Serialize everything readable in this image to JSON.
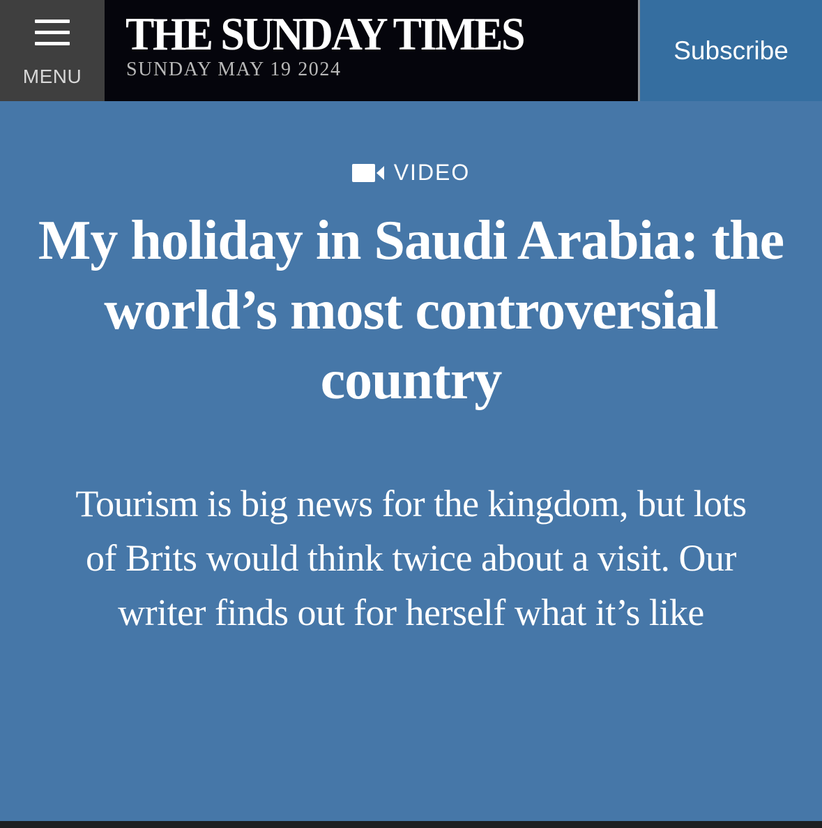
{
  "header": {
    "menu_label": "MENU",
    "masthead_title": "THE SUNDAY TIMES",
    "masthead_date": "SUNDAY MAY 19 2024",
    "subscribe_label": "Subscribe"
  },
  "article": {
    "label": "VIDEO",
    "label_icon": "video-camera-icon",
    "headline": "My holiday in Saudi Arabia: the world’s most controversial country",
    "standfirst": "Tourism is big news for the kingdom, but lots of Brits would think twice about a visit. Our writer finds out for herself what it’s like"
  },
  "colors": {
    "hero_background": "#4677a8",
    "masthead_background": "#05050c",
    "menu_background": "#3f3f3f",
    "subscribe_background": "#356ea0",
    "text": "#ffffff"
  }
}
